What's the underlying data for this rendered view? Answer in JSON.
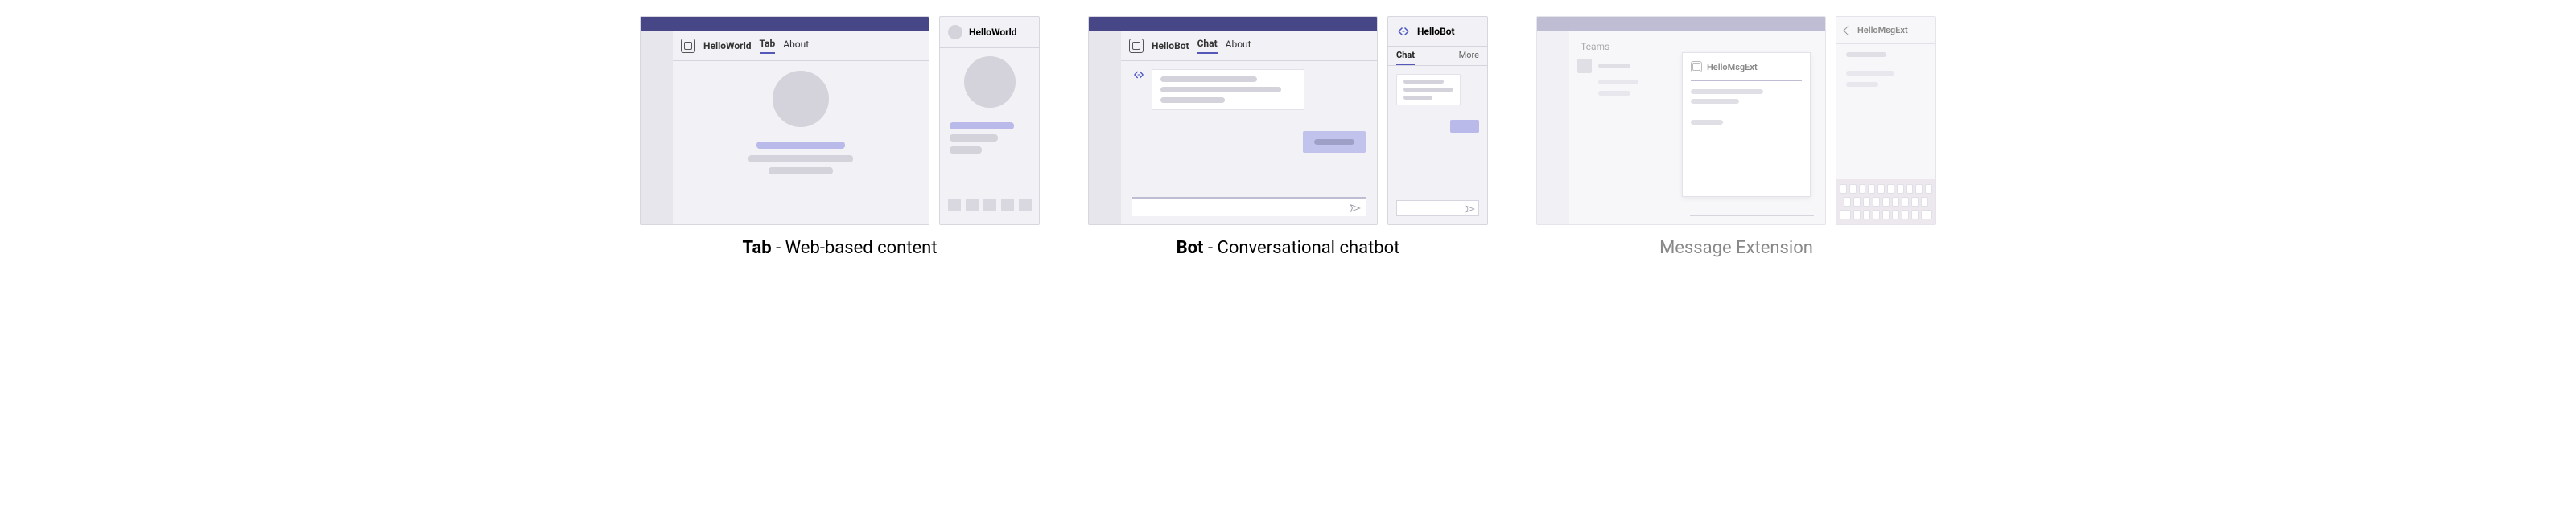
{
  "groups": {
    "tab": {
      "desktop": {
        "app_name": "HelloWorld",
        "tabs": [
          "Tab",
          "About"
        ],
        "active_tab_index": 0
      },
      "mobile": {
        "title": "HelloWorld"
      },
      "caption_bold": "Tab",
      "caption_rest": " - Web-based content"
    },
    "bot": {
      "desktop": {
        "app_name": "HelloBot",
        "tabs": [
          "Chat",
          "About"
        ],
        "active_tab_index": 0
      },
      "mobile": {
        "title": "HelloBot",
        "tabs": [
          "Chat",
          "More"
        ],
        "active_tab_index": 0
      },
      "caption_bold": "Bot",
      "caption_rest": " - Conversational chatbot"
    },
    "msgext": {
      "desktop": {
        "side_label": "Teams",
        "card_title": "HelloMsgExt"
      },
      "mobile": {
        "title": "HelloMsgExt"
      },
      "caption": "Message Extension"
    }
  }
}
